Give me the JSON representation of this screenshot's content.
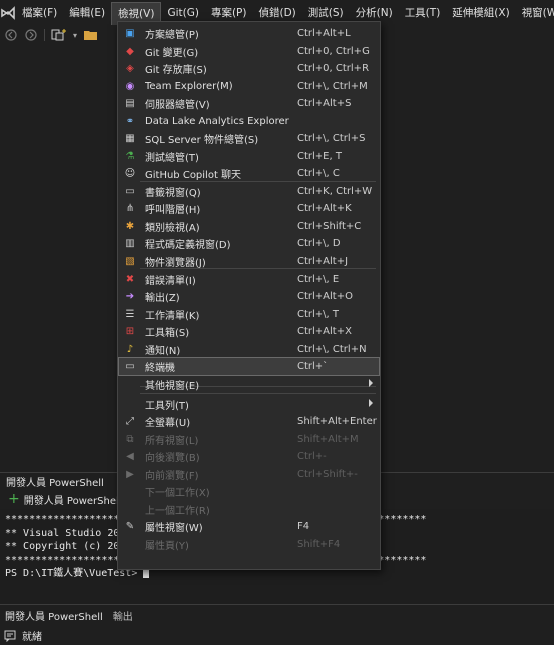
{
  "menubar": {
    "items": [
      "檔案(F)",
      "編輯(E)",
      "檢視(V)",
      "Git(G)",
      "專案(P)",
      "偵錯(D)",
      "測試(S)",
      "分析(N)",
      "工具(T)",
      "延伸模組(X)",
      "視窗(W)"
    ],
    "active_index": 2
  },
  "view_menu": {
    "items": [
      {
        "label": "方案總管(P)",
        "shortcut": "Ctrl+Alt+L",
        "icon": "solution-explorer-icon",
        "icon_color": "#4aa3f0",
        "disabled": false
      },
      {
        "label": "Git 變更(G)",
        "shortcut": "Ctrl+0, Ctrl+G",
        "icon": "git-changes-icon",
        "icon_color": "#e04848",
        "disabled": false
      },
      {
        "label": "Git 存放庫(S)",
        "shortcut": "Ctrl+0, Ctrl+R",
        "icon": "git-repository-icon",
        "icon_color": "#e04848",
        "disabled": false
      },
      {
        "label": "Team Explorer(M)",
        "shortcut": "Ctrl+\\, Ctrl+M",
        "icon": "team-explorer-icon",
        "icon_color": "#c78cff",
        "disabled": false
      },
      {
        "label": "伺服器總管(V)",
        "shortcut": "Ctrl+Alt+S",
        "icon": "server-explorer-icon",
        "icon_color": "#cccccc",
        "disabled": false
      },
      {
        "label": "Data Lake Analytics Explorer",
        "shortcut": "",
        "icon": "data-lake-icon",
        "icon_color": "#7fb8f0",
        "disabled": false
      },
      {
        "label": "SQL Server 物件總管(S)",
        "shortcut": "Ctrl+\\, Ctrl+S",
        "icon": "sql-server-icon",
        "icon_color": "#cccccc",
        "disabled": false
      },
      {
        "label": "測試總管(T)",
        "shortcut": "Ctrl+E, T",
        "icon": "test-explorer-icon",
        "icon_color": "#4caf50",
        "disabled": false
      },
      {
        "label": "GitHub Copilot 聊天",
        "shortcut": "Ctrl+\\, C",
        "icon": "copilot-icon",
        "icon_color": "#e0e0e0",
        "disabled": false
      },
      {
        "label": "書籤視窗(Q)",
        "shortcut": "Ctrl+K, Ctrl+W",
        "icon": "bookmark-window-icon",
        "icon_color": "#cccccc",
        "disabled": false
      },
      {
        "label": "呼叫階層(H)",
        "shortcut": "Ctrl+Alt+K",
        "icon": "call-hierarchy-icon",
        "icon_color": "#cccccc",
        "disabled": false
      },
      {
        "label": "類別檢視(A)",
        "shortcut": "Ctrl+Shift+C",
        "icon": "class-view-icon",
        "icon_color": "#e8a33c",
        "disabled": false
      },
      {
        "label": "程式碼定義視窗(D)",
        "shortcut": "Ctrl+\\, D",
        "icon": "code-definition-icon",
        "icon_color": "#cccccc",
        "disabled": false
      },
      {
        "label": "物件瀏覽器(J)",
        "shortcut": "Ctrl+Alt+J",
        "icon": "object-browser-icon",
        "icon_color": "#e8a33c",
        "disabled": false
      },
      {
        "label": "錯誤清單(I)",
        "shortcut": "Ctrl+\\, E",
        "icon": "error-list-icon",
        "icon_color": "#e04848",
        "disabled": false
      },
      {
        "label": "輸出(Z)",
        "shortcut": "Ctrl+Alt+O",
        "icon": "output-icon",
        "icon_color": "#c78cff",
        "disabled": false
      },
      {
        "label": "工作清單(K)",
        "shortcut": "Ctrl+\\, T",
        "icon": "task-list-icon",
        "icon_color": "#cccccc",
        "disabled": false
      },
      {
        "label": "工具箱(S)",
        "shortcut": "Ctrl+Alt+X",
        "icon": "toolbox-icon",
        "icon_color": "#e04848",
        "disabled": false
      },
      {
        "label": "通知(N)",
        "shortcut": "Ctrl+\\, Ctrl+N",
        "icon": "bell-icon",
        "icon_color": "#e8c33c",
        "disabled": false
      },
      {
        "label": "終端機",
        "shortcut": "Ctrl+`",
        "icon": "terminal-icon",
        "icon_color": "#cccccc",
        "disabled": false,
        "highlighted": true
      },
      {
        "label": "其他視窗(E)",
        "shortcut": "",
        "icon": "",
        "icon_color": "",
        "disabled": false,
        "submenu": true
      },
      {
        "label": "工具列(T)",
        "shortcut": "",
        "icon": "",
        "icon_color": "",
        "disabled": false,
        "submenu": true
      },
      {
        "label": "全螢幕(U)",
        "shortcut": "Shift+Alt+Enter",
        "icon": "fullscreen-icon",
        "icon_color": "#cccccc",
        "disabled": false
      },
      {
        "label": "所有視窗(L)",
        "shortcut": "Shift+Alt+M",
        "icon": "all-windows-icon",
        "icon_color": "#6b6b6b",
        "disabled": true
      },
      {
        "label": "向後瀏覽(B)",
        "shortcut": "Ctrl+-",
        "icon": "navigate-back-icon",
        "icon_color": "#6b6b6b",
        "disabled": true
      },
      {
        "label": "向前瀏覽(F)",
        "shortcut": "Ctrl+Shift+-",
        "icon": "navigate-forward-icon",
        "icon_color": "#6b6b6b",
        "disabled": true
      },
      {
        "label": "下一個工作(X)",
        "shortcut": "",
        "icon": "",
        "icon_color": "",
        "disabled": true
      },
      {
        "label": "上一個工作(R)",
        "shortcut": "",
        "icon": "",
        "icon_color": "",
        "disabled": true
      },
      {
        "label": "屬性視窗(W)",
        "shortcut": "F4",
        "icon": "wrench-icon",
        "icon_color": "#cccccc",
        "disabled": false
      },
      {
        "label": "屬性頁(Y)",
        "shortcut": "Shift+F4",
        "icon": "",
        "icon_color": "",
        "disabled": true
      }
    ]
  },
  "panel": {
    "title": "開發人員 PowerShell",
    "toolbar_label": "開發人員 PowerShell",
    "terminal_lines": [
      "**********************************************************************",
      "** Visual Studio 2022",
      "** Copyright (c) 2022",
      "**********************************************************************",
      "PS D:\\IT鐵人賽\\VueTest> "
    ],
    "tabs": [
      "開發人員 PowerShell",
      "輸出"
    ]
  },
  "statusbar": {
    "text": "就緒"
  }
}
